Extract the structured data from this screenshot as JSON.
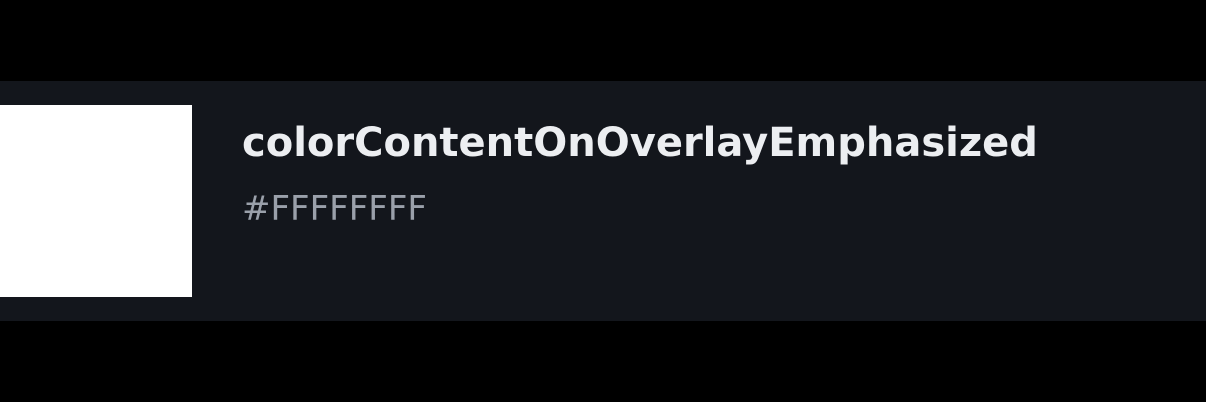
{
  "token": {
    "name": "colorContentOnOverlayEmphasized",
    "value": "#FFFFFFFF",
    "swatch_color": "#FFFFFF"
  },
  "colors": {
    "page_background": "#000000",
    "row_background": "#13161C",
    "name_text": "#ECEEF1",
    "value_text": "#9AA0AA"
  }
}
